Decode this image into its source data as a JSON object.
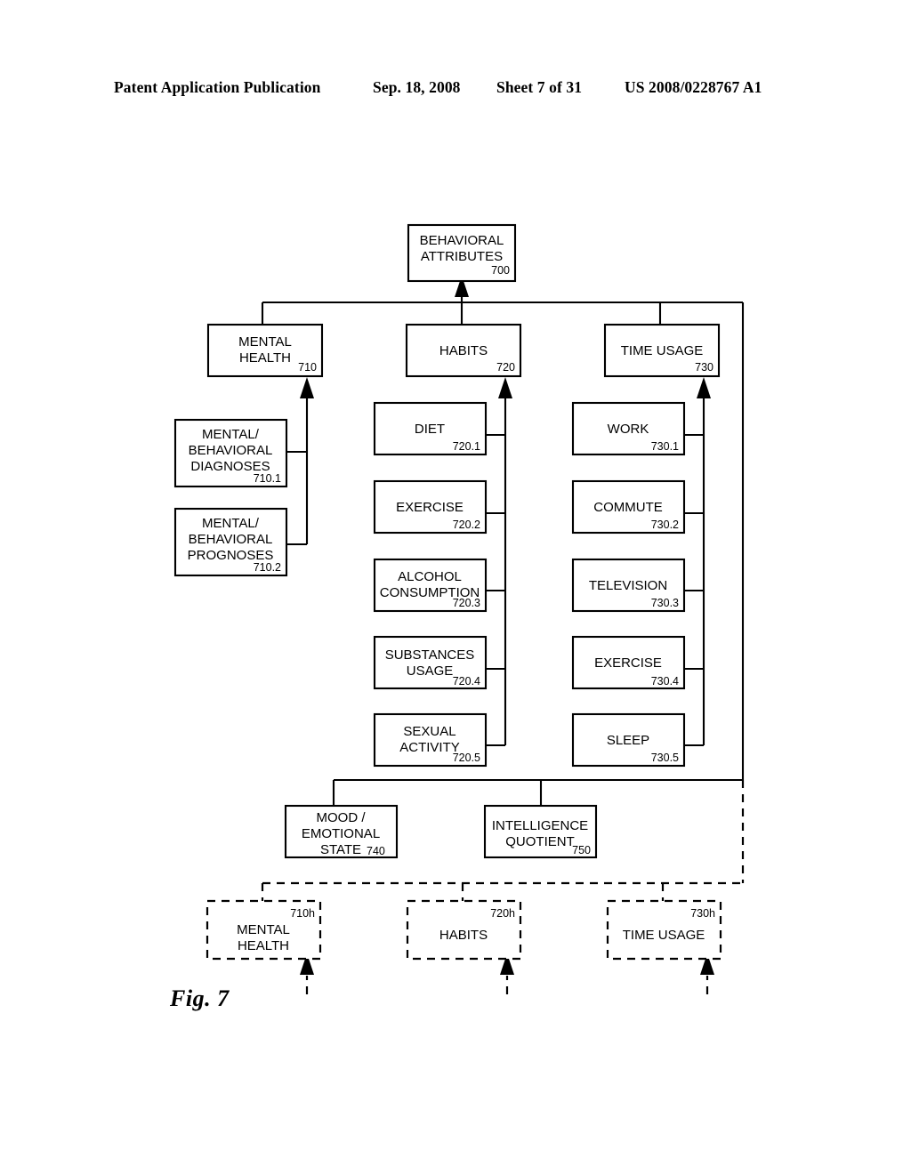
{
  "header": {
    "publication": "Patent Application Publication",
    "date": "Sep. 18, 2008",
    "sheet": "Sheet 7 of 31",
    "number": "US 2008/0228767 A1"
  },
  "figure": {
    "caption": "Fig. 7"
  },
  "diagram": {
    "root": {
      "label_line1": "BEHAVIORAL",
      "label_line2": "ATTRIBUTES",
      "ref": "700"
    },
    "level2": [
      {
        "label_line1": "MENTAL",
        "label_line2": "HEALTH",
        "ref": "710"
      },
      {
        "label_line1": "HABITS",
        "label_line2": "",
        "ref": "720"
      },
      {
        "label_line1": "TIME USAGE",
        "label_line2": "",
        "ref": "730"
      }
    ],
    "mental_health_children": [
      {
        "label_line1": "MENTAL/",
        "label_line2": "BEHAVIORAL",
        "label_line3": "DIAGNOSES",
        "ref": "710.1"
      },
      {
        "label_line1": "MENTAL/",
        "label_line2": "BEHAVIORAL",
        "label_line3": "PROGNOSES",
        "ref": "710.2"
      }
    ],
    "habits_children": [
      {
        "label_line1": "DIET",
        "label_line2": "",
        "ref": "720.1"
      },
      {
        "label_line1": "EXERCISE",
        "label_line2": "",
        "ref": "720.2"
      },
      {
        "label_line1": "ALCOHOL",
        "label_line2": "CONSUMPTION",
        "ref": "720.3"
      },
      {
        "label_line1": "SUBSTANCES",
        "label_line2": "USAGE",
        "ref": "720.4"
      },
      {
        "label_line1": "SEXUAL",
        "label_line2": "ACTIVITY",
        "ref": "720.5"
      }
    ],
    "time_usage_children": [
      {
        "label_line1": "WORK",
        "label_line2": "",
        "ref": "730.1"
      },
      {
        "label_line1": "COMMUTE",
        "label_line2": "",
        "ref": "730.2"
      },
      {
        "label_line1": "TELEVISION",
        "label_line2": "",
        "ref": "730.3"
      },
      {
        "label_line1": "EXERCISE",
        "label_line2": "",
        "ref": "730.4"
      },
      {
        "label_line1": "SLEEP",
        "label_line2": "",
        "ref": "730.5"
      }
    ],
    "other_attributes": [
      {
        "label_line1": "MOOD /",
        "label_line2": "EMOTIONAL",
        "label_line3": "STATE",
        "ref": "740"
      },
      {
        "label_line1": "INTELLIGENCE",
        "label_line2": "QUOTIENT",
        "label_line3": "",
        "ref": "750"
      }
    ],
    "history_boxes": [
      {
        "label_line1": "MENTAL",
        "label_line2": "HEALTH",
        "ref": "710h"
      },
      {
        "label_line1": "HABITS",
        "label_line2": "",
        "ref": "720h"
      },
      {
        "label_line1": "TIME USAGE",
        "label_line2": "",
        "ref": "730h"
      }
    ]
  }
}
